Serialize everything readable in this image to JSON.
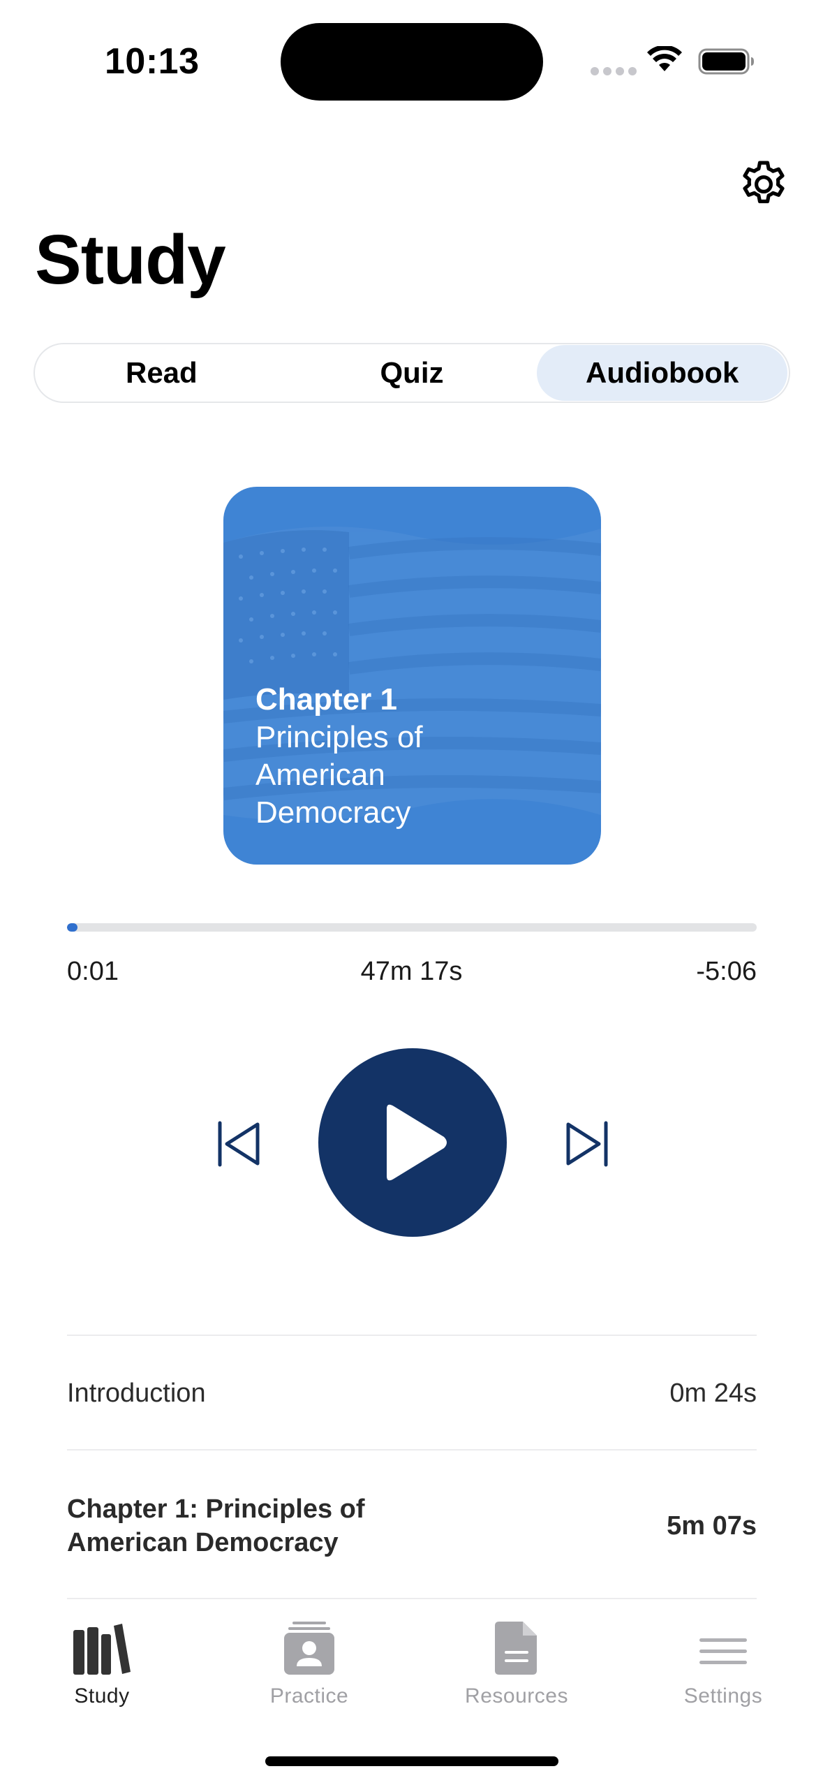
{
  "status_bar": {
    "time": "10:13"
  },
  "header": {
    "title": "Study",
    "settings_icon": "gear-icon"
  },
  "segmented_control": {
    "selected": "Audiobook",
    "segments": [
      {
        "label": "Read"
      },
      {
        "label": "Quiz"
      },
      {
        "label": "Audiobook"
      }
    ]
  },
  "cover": {
    "chapter": "Chapter 1",
    "subtitle": "Principles of American Democracy",
    "background_color": "#3f84d4",
    "image": "american-flag"
  },
  "player": {
    "progress_fraction": 0.015,
    "elapsed": "0:01",
    "total": "47m 17s",
    "remaining": "-5:06",
    "accent_color": "#2f6fcd",
    "play_button_color": "#133366",
    "play_icon": "play-icon",
    "prev_icon": "skip-back-icon",
    "next_icon": "skip-forward-icon"
  },
  "tracks": [
    {
      "title": "Introduction",
      "duration": "0m 24s",
      "current": false
    },
    {
      "title": "Chapter 1: Principles of American Democracy",
      "duration": "5m 07s",
      "current": true
    }
  ],
  "tab_bar": {
    "selected": "Study",
    "tabs": [
      {
        "label": "Study",
        "icon": "books-icon"
      },
      {
        "label": "Practice",
        "icon": "id-card-icon"
      },
      {
        "label": "Resources",
        "icon": "document-icon"
      },
      {
        "label": "Settings",
        "icon": "hamburger-icon"
      }
    ]
  }
}
